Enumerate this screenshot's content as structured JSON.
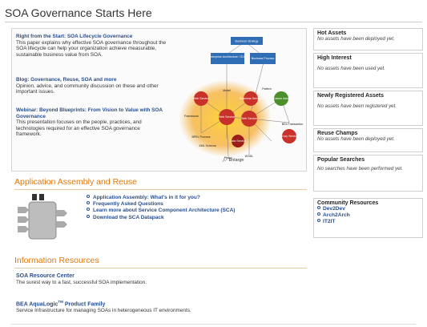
{
  "page": {
    "title": "SOA Governance Starts Here"
  },
  "feature": {
    "promos": [
      {
        "title": "Right from the Start: SOA Lifecycle Governance",
        "body": "This paper explains why effective SOA governance throughout the SOA lifecycle can help your organization achieve measurable, sustainable business value from SOA."
      },
      {
        "title": "Blog: Governance, Reuse, SOA and more",
        "body": "Opinion, advice, and community discussion on these and other important issues."
      },
      {
        "title": "Webinar: Beyond Blueprints: From Vision to Value with SOA Governance",
        "body": "This presentation focuses on the people, practices, and technologies required for an effective SOA governance framework."
      }
    ],
    "diagram": {
      "boxes": [
        "Business Strategy",
        "Enterprise Architecture / SOA",
        "Business Process"
      ],
      "nodes": [
        "Web Service",
        "Model",
        "Business Service",
        "Pattern",
        "Custom Asset",
        "Framework",
        "Web Service",
        "Web Service",
        "BEA Transaction",
        "BPEL Process",
        "XML Schema",
        "Policy",
        "WSDL",
        "Proxy Service",
        "Data Service"
      ],
      "enlarge_label": "Enlarge"
    }
  },
  "sidebar": {
    "hot_assets": {
      "title": "Hot Assets",
      "body": "No assets have been deployed yet."
    },
    "high_interest": {
      "title": "High Interest",
      "body": "No assets have been used yet."
    },
    "newly_registered": {
      "title": "Newly Registered Assets",
      "body": "No assets have been registered yet."
    },
    "reuse_champs": {
      "title": "Reuse Champs",
      "body": "No assets have been deployed yet."
    },
    "popular_searches": {
      "title": "Popular Searches",
      "body": "No searches have been performed yet."
    },
    "community": {
      "title": "Community Resources",
      "links": [
        "Dev2Dev",
        "Arch2Arch",
        "IT2IT"
      ]
    }
  },
  "assembly": {
    "title": "Application Assembly and Reuse",
    "links": [
      "Application Assembly: What's in it for you?",
      "Frequently Asked Questions",
      "Learn more about Service Component Architecture (SCA)",
      "Download the SCA Datapack"
    ]
  },
  "resources": {
    "title": "Information Resources",
    "items": [
      {
        "title": "SOA Resource Center",
        "body": "The surest way to a fast, successful SOA implementation."
      },
      {
        "title_pre": "BEA AquaLogic",
        "title_sup": "TM",
        "title_post": " Product Family",
        "body": "Service Infrastructure for managing SOAs in heterogeneous IT environments."
      }
    ]
  },
  "colors": {
    "link": "#2a4f8c",
    "section": "#e0780c",
    "box_blue": "#2f6eb5",
    "node_red": "#c8322a",
    "node_green": "#4a8f2a"
  }
}
